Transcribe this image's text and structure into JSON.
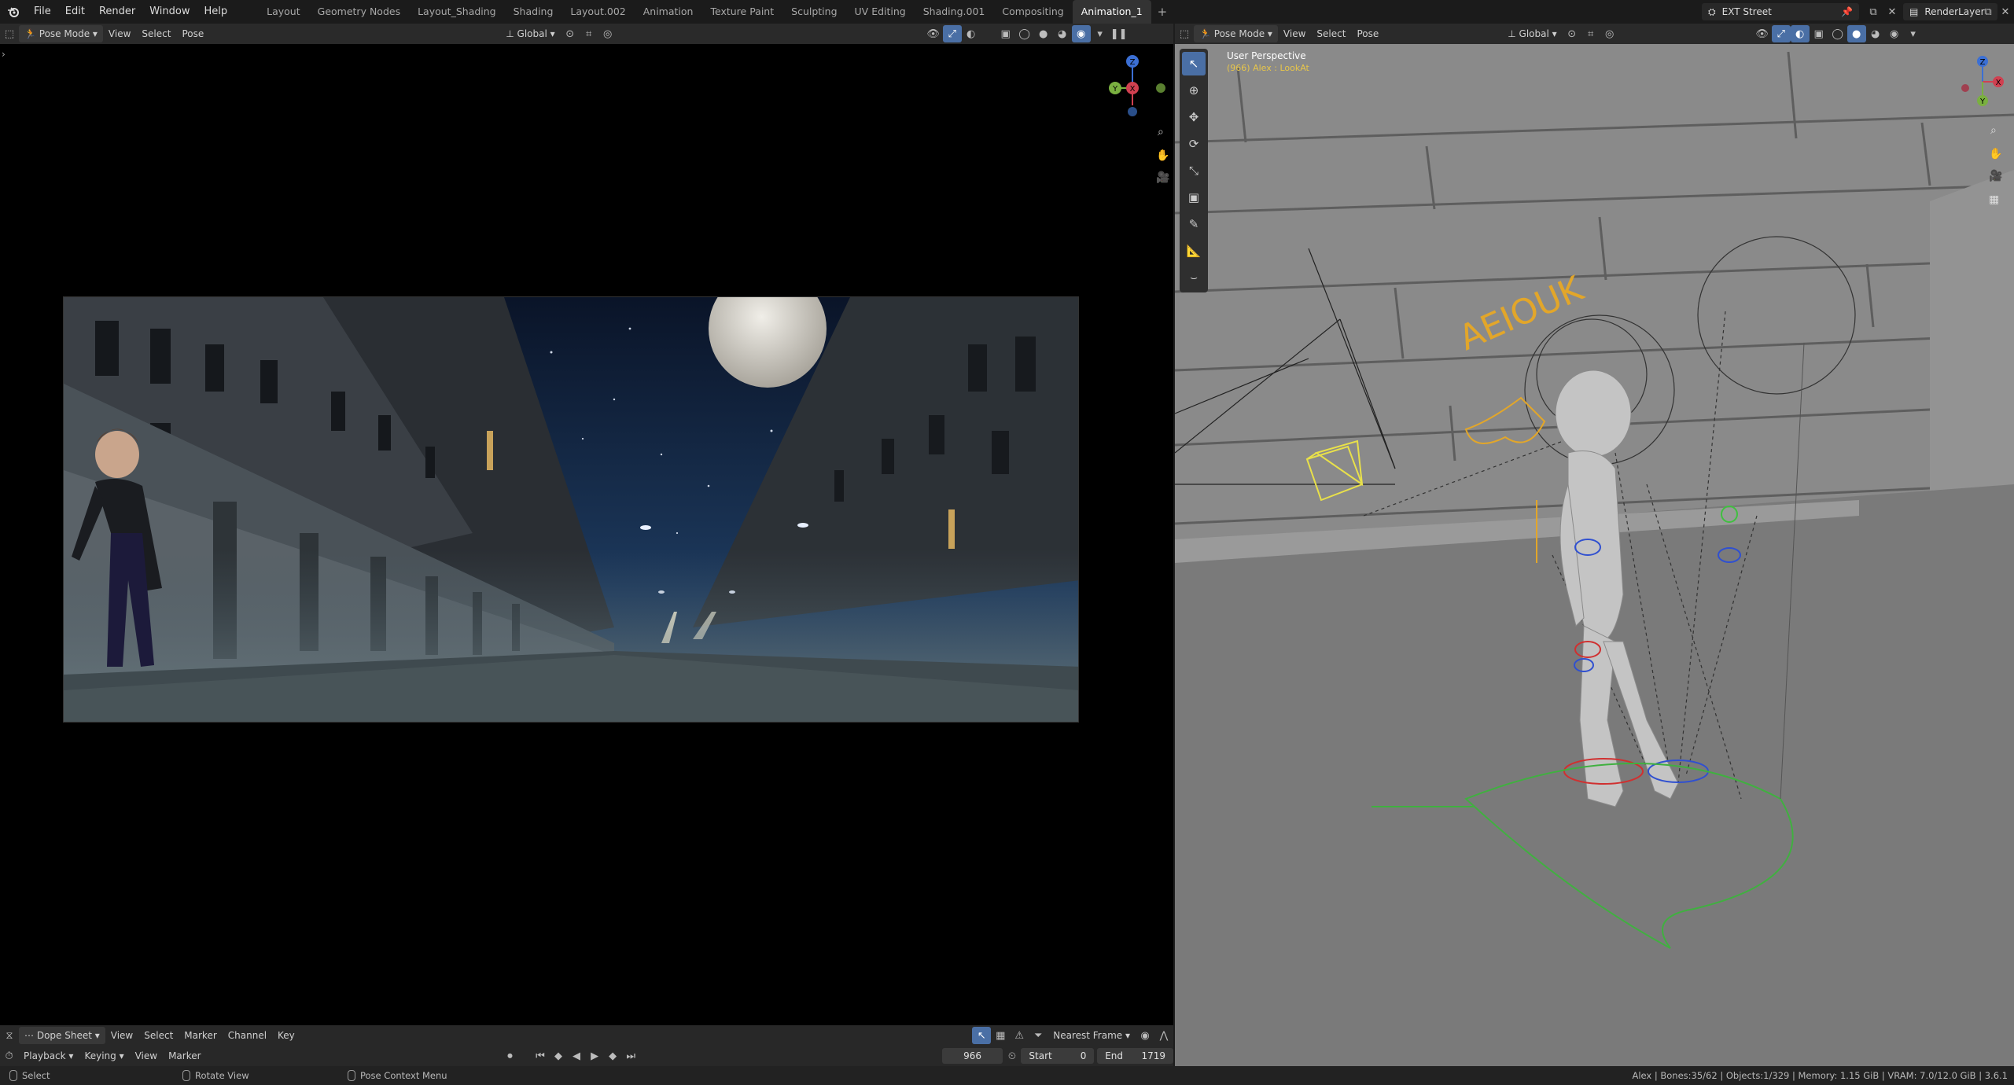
{
  "menu": {
    "items": [
      "File",
      "Edit",
      "Render",
      "Window",
      "Help"
    ],
    "workspaces": [
      "Layout",
      "Geometry Nodes",
      "Layout_Shading",
      "Shading",
      "Layout.002",
      "Animation",
      "Texture Paint",
      "Sculpting",
      "UV Editing",
      "Shading.001",
      "Compositing",
      "Animation_1"
    ],
    "active_workspace": "Animation_1",
    "scene": "EXT Street",
    "view_layer": "RenderLayer"
  },
  "left_header": {
    "mode": "Pose Mode",
    "menus": [
      "View",
      "Select",
      "Pose"
    ],
    "orientation": "Global"
  },
  "right_header": {
    "mode": "Pose Mode",
    "menus": [
      "View",
      "Select",
      "Pose"
    ],
    "orientation": "Global"
  },
  "right_viewport": {
    "title": "User Perspective",
    "subtitle": "(966) Alex : LookAt",
    "lip_sync_letters": "AEIOUK"
  },
  "gizmo": {
    "x": "X",
    "y": "Y",
    "z": "Z"
  },
  "dopesheet": {
    "editor": "Dope Sheet",
    "menus": [
      "View",
      "Select",
      "Marker",
      "Channel",
      "Key"
    ],
    "snapping": "Nearest Frame",
    "playback_menus": [
      "Playback",
      "Keying",
      "View",
      "Marker"
    ],
    "current_frame": "966",
    "start_label": "Start",
    "start_value": "0",
    "end_label": "End",
    "end_value": "1719"
  },
  "statusbar": {
    "select": "Select",
    "rotate": "Rotate View",
    "context": "Pose Context Menu",
    "info": "Alex | Bones:35/62 | Objects:1/329 | Memory: 1.15 GiB | VRAM: 7.0/12.0 GiB | 3.6.1"
  },
  "colors": {
    "accent": "#4a6fa5",
    "active_text": "#e8c64a",
    "viewport_bg": "#777777"
  }
}
